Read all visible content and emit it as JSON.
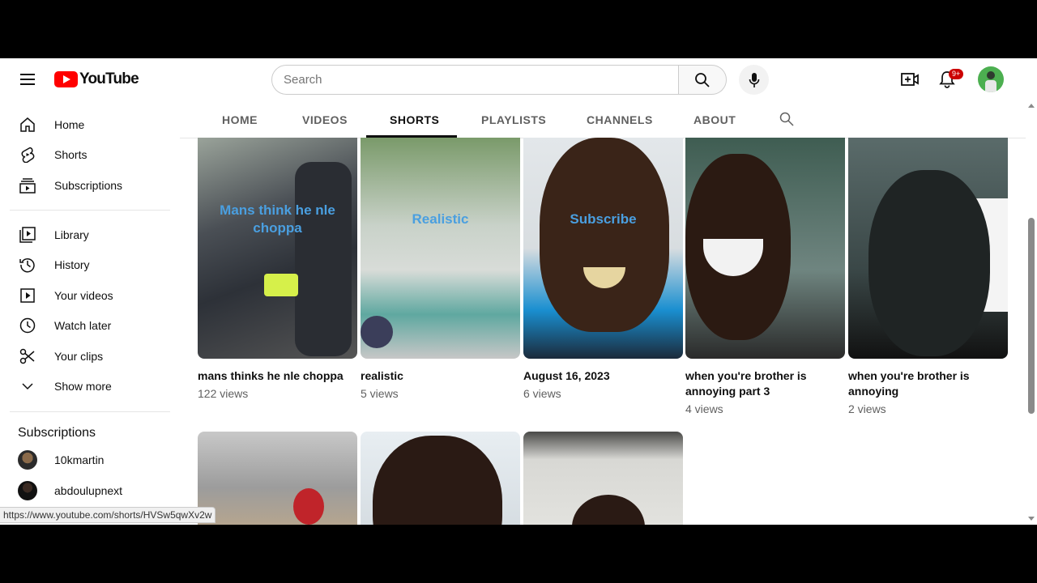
{
  "header": {
    "logo_text": "YouTube",
    "search_placeholder": "Search",
    "notification_count": "9+"
  },
  "sidebar": {
    "main": [
      {
        "label": "Home",
        "icon": "home-icon"
      },
      {
        "label": "Shorts",
        "icon": "shorts-icon"
      },
      {
        "label": "Subscriptions",
        "icon": "subscriptions-icon"
      }
    ],
    "library": [
      {
        "label": "Library",
        "icon": "library-icon"
      },
      {
        "label": "History",
        "icon": "history-icon"
      },
      {
        "label": "Your videos",
        "icon": "your-videos-icon"
      },
      {
        "label": "Watch later",
        "icon": "watch-later-icon"
      },
      {
        "label": "Your clips",
        "icon": "scissors-icon"
      },
      {
        "label": "Show more",
        "icon": "chevron-down-icon"
      }
    ],
    "subscriptions_heading": "Subscriptions",
    "subscriptions": [
      {
        "label": "10kmartin"
      },
      {
        "label": "abdoulupnext"
      }
    ]
  },
  "tabs": [
    {
      "label": "HOME"
    },
    {
      "label": "VIDEOS"
    },
    {
      "label": "SHORTS",
      "active": true
    },
    {
      "label": "PLAYLISTS"
    },
    {
      "label": "CHANNELS"
    },
    {
      "label": "ABOUT"
    }
  ],
  "shorts": [
    {
      "title": "mans thinks he nle choppa",
      "views": "122 views",
      "overlay": "Mans think he nle choppa"
    },
    {
      "title": "realistic",
      "views": "5 views",
      "overlay": "Realistic"
    },
    {
      "title": "August 16, 2023",
      "views": "6 views",
      "overlay": "Subscribe"
    },
    {
      "title": "when you're brother is annoying part 3",
      "views": "4 views",
      "overlay": ""
    },
    {
      "title": "when you're brother is annoying",
      "views": "2 views",
      "overlay": ""
    }
  ],
  "status_url": "https://www.youtube.com/shorts/HVSw5qwXv2w",
  "colors": {
    "brand": "#ff0000",
    "overlay_text": "#4a9fe0"
  }
}
